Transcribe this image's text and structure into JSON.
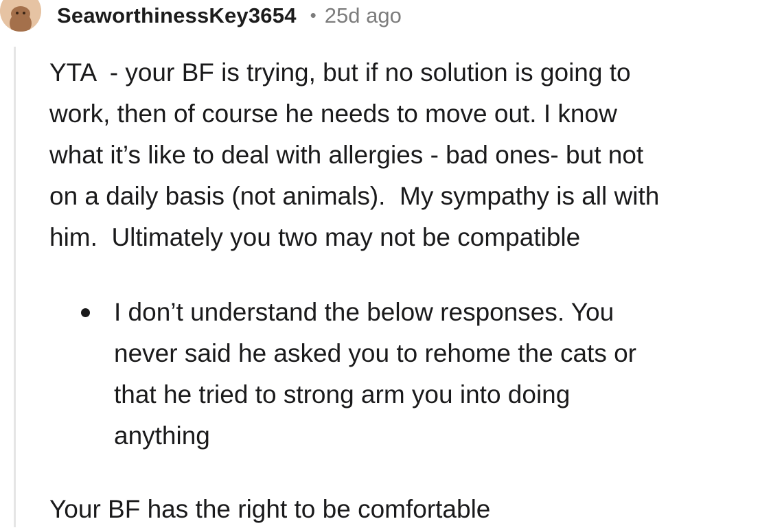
{
  "comment": {
    "author": "SeaworthinessKey3654",
    "separator": "•",
    "timestamp": "25d ago",
    "avatar_icon": "snoo-avatar-icon",
    "paragraph1_lines": [
      "YTA  - your BF is trying, but if no solution is going to",
      "work, then of course he needs to move out. I know",
      "what it’s like to deal with allergies - bad ones- but not",
      "on a daily basis (not animals).  My sympathy is all with",
      "him.  Ultimately you two may not be compatible"
    ],
    "bullet_lines": [
      "I don’t understand the below responses. You",
      "never said he asked you to rehome the cats or",
      "that he tried to strong arm you into doing",
      "anything"
    ],
    "closing": "Your BF has the right to be comfortable"
  },
  "colors": {
    "text": "#1a1a1b",
    "meta": "#7c7c7c",
    "thread_line": "#e5e5e5",
    "avatar": "#e6c3a3"
  }
}
